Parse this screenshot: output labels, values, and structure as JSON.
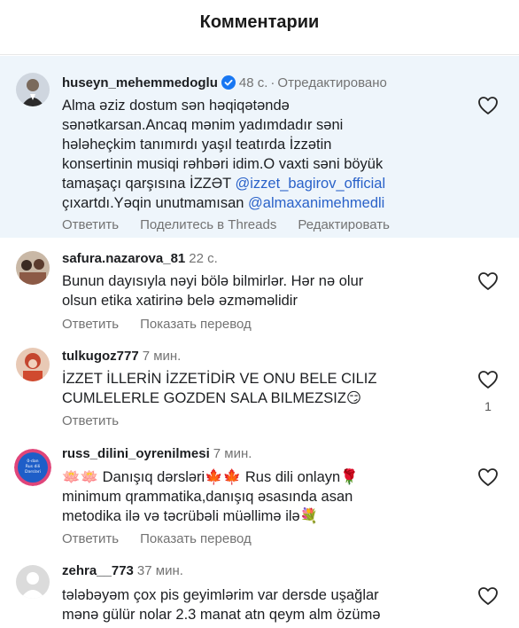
{
  "header": {
    "title": "Комментарии"
  },
  "comments": [
    {
      "username": "huseyn_mehemmedoglu",
      "verified": true,
      "time": "48 с.",
      "separator": "·",
      "edited": "Отредактировано",
      "text_lines": [
        "Alma əziz dostum sən həqiqətəndə",
        "sənətkarsan.Ancaq mənim yadımdadır səni",
        "hələheçkim tanımırdı yaşıl teatırda İzzətin",
        "konsertinin musiqi rəhbəri idim.O vaxti səni böyük",
        "tamaşaçı qarşısına İZZƏT "
      ],
      "mention1": "@izzet_bagirov_official",
      "text_line6": "çıxartdı.Yəqin unutmamısan ",
      "mention2": "@almaxanimehmedli",
      "actions": [
        "Ответить",
        "Поделитесь в Threads",
        "Редактировать"
      ]
    },
    {
      "username": "safura.nazarova_81",
      "time": "22 с.",
      "text": "Bunun dayısıyla nəyi bölə bilmirlər. Hər nə olur\nolsun etika xatirinə belə əzməməlidir",
      "actions": [
        "Ответить",
        "Показать перевод"
      ]
    },
    {
      "username": "tulkugoz777",
      "time": "7 мин.",
      "text": "İZZET İLLERİN İZZETİDİR VE ONU BELE CILIZ\nCUMLELERLE GOZDEN SALA BILMEZSIZ😏",
      "actions": [
        "Ответить"
      ],
      "likes": "1"
    },
    {
      "username": "russ_dilini_oyrenilmesi",
      "time": "7 мин.",
      "text": "🪷🪷 Danışıq dərsləri🍁🍁 Rus dili onlayn🌹\nminimum qrammatika,danışıq əsasında asan\nmetodika ilə və təcrübəli müəllimə ilə💐",
      "actions": [
        "Ответить",
        "Показать перевод"
      ],
      "avatar_text": [
        "0-dan",
        "Rus dili",
        "Dərsləri"
      ]
    },
    {
      "username": "zehra__773",
      "time": "37 мин.",
      "text": "tələbəyəm çox pis geyimlərim var dersde uşağlar\nmənə gülür nolar 2.3 manat atn qeym alm özümə",
      "actions": []
    }
  ],
  "colors": {
    "accent": "#2a62c9",
    "highlight": "#eef5fb",
    "muted": "#737373",
    "verified": "#1877f2"
  }
}
